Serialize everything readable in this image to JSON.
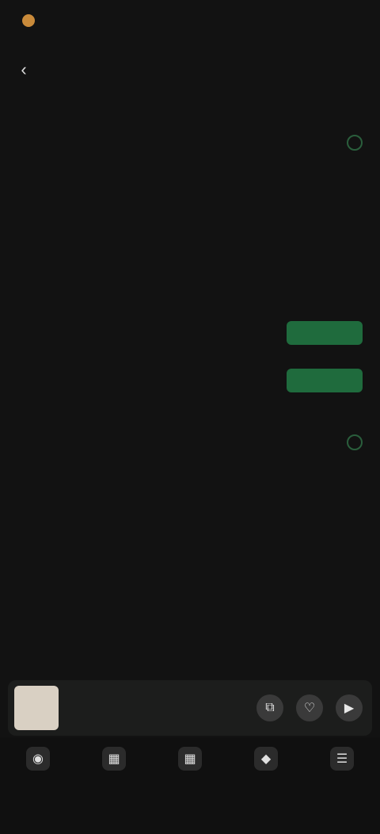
{
  "status": {
    "time": "",
    "right_text": ""
  },
  "header": {
    "title": ""
  },
  "section": {
    "title": "",
    "description": ""
  },
  "subsection": {
    "title": "",
    "description": ""
  },
  "rows": [
    {
      "label": "",
      "control": "radio"
    },
    {
      "label": "",
      "control": "none"
    },
    {
      "label": "",
      "control": "none"
    },
    {
      "label": "",
      "control": "none"
    },
    {
      "label": "",
      "control": "button",
      "button_label": ""
    },
    {
      "label": "",
      "control": "button",
      "button_label": ""
    }
  ],
  "subsection2": {
    "title": "",
    "description": ""
  },
  "row_last": {
    "label": "",
    "control": "radio"
  },
  "mini_player": {
    "title": "",
    "artist": ""
  },
  "icons": {
    "back": "‹",
    "nav": [
      "◉",
      "▦",
      "▦",
      "◆",
      "☰"
    ]
  },
  "bottom_nav": [
    {
      "label": ""
    },
    {
      "label": ""
    },
    {
      "label": ""
    },
    {
      "label": ""
    },
    {
      "label": ""
    }
  ],
  "colors": {
    "accent_green": "#1f6b3d",
    "background": "#121212"
  }
}
